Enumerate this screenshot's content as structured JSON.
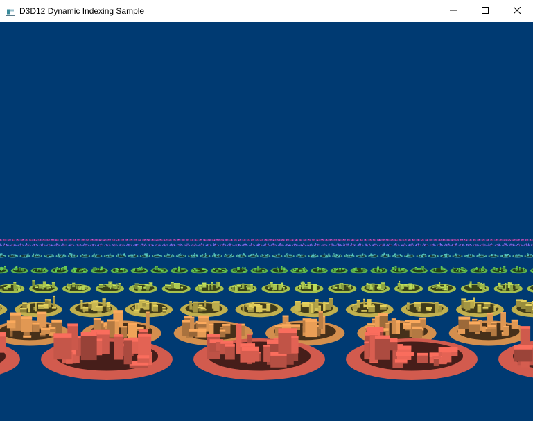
{
  "window": {
    "title": "D3D12 Dynamic Indexing Sample",
    "app_icon": "window-app-icon",
    "controls": {
      "minimize": "minimize-icon",
      "maximize": "maximize-icon",
      "close": "close-icon"
    }
  },
  "scene": {
    "background_color": "#003a72",
    "row_colors": [
      "#c8574a",
      "#c9884a",
      "#b8a84a",
      "#9eb84a",
      "#5bae4a",
      "#4aa6a0",
      "#6a5fd0",
      "#b04ab0"
    ]
  }
}
